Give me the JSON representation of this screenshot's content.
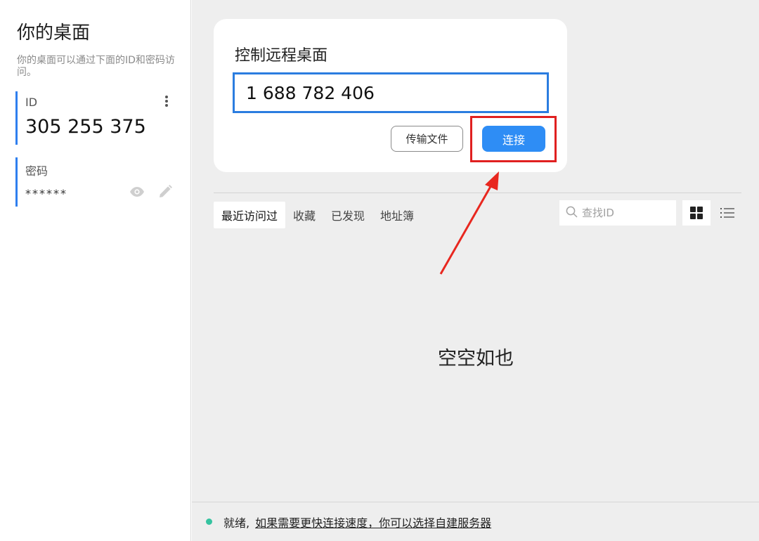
{
  "sidebar": {
    "title": "你的桌面",
    "description": "你的桌面可以通过下面的ID和密码访问。",
    "id_label": "ID",
    "id_value": "305 255 375",
    "password_label": "密码",
    "password_value": "******"
  },
  "connect_card": {
    "title": "控制远程桌面",
    "remote_id_value": "1 688 782 406",
    "file_transfer_label": "传输文件",
    "connect_label": "连接"
  },
  "tabs": [
    {
      "label": "最近访问过",
      "active": true
    },
    {
      "label": "收藏",
      "active": false
    },
    {
      "label": "已发现",
      "active": false
    },
    {
      "label": "地址簿",
      "active": false
    }
  ],
  "search": {
    "placeholder": "查找ID"
  },
  "empty_state": "空空如也",
  "status": {
    "ready_text": "就绪,",
    "link_text": "如果需要更快连接速度，你可以选择自建服务器"
  },
  "colors": {
    "accent": "#2e8df5",
    "input_border": "#2b7de0",
    "highlight": "#e02020",
    "status_ok": "#35c3a0"
  }
}
